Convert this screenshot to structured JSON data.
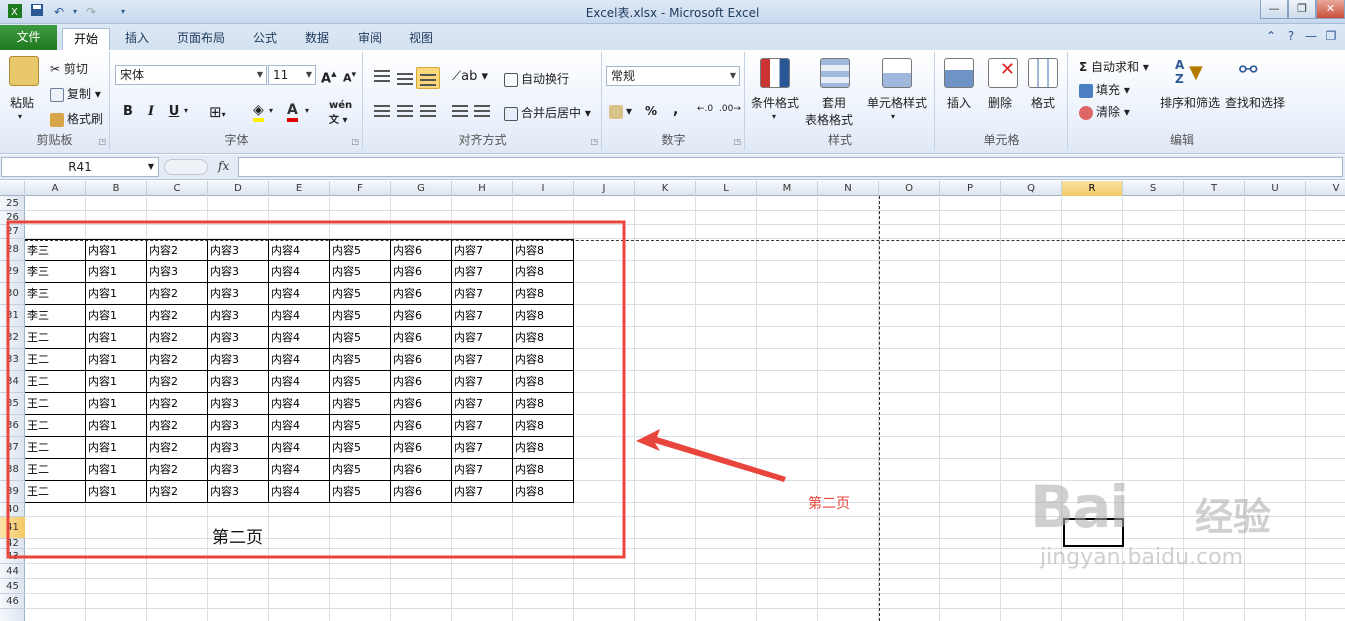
{
  "window": {
    "title": "Excel表.xlsx - Microsoft Excel"
  },
  "tabs": {
    "file": "文件",
    "items": [
      "开始",
      "插入",
      "页面布局",
      "公式",
      "数据",
      "审阅",
      "视图"
    ]
  },
  "ribbon": {
    "clipboard": {
      "paste": "粘贴",
      "cut": "剪切",
      "copy": "复制",
      "format_painter": "格式刷",
      "label": "剪贴板"
    },
    "font": {
      "name": "宋体",
      "size": "11",
      "label": "字体",
      "bold": "B",
      "italic": "I",
      "underline": "U"
    },
    "alignment": {
      "wrap": "自动换行",
      "merge": "合并后居中",
      "label": "对齐方式"
    },
    "number": {
      "format": "常规",
      "label": "数字",
      "percent": "%",
      "comma": ","
    },
    "styles": {
      "conditional": "条件格式",
      "table_line1": "套用",
      "table_line2": "表格格式",
      "cell_styles": "单元格样式",
      "label": "样式"
    },
    "cells": {
      "insert": "插入",
      "delete": "删除",
      "format": "格式",
      "label": "单元格"
    },
    "editing": {
      "autosum": "自动求和",
      "fill": "填充",
      "clear": "清除",
      "sort": "排序和筛选",
      "find": "查找和选择",
      "label": "编辑"
    }
  },
  "formula_bar": {
    "name_box": "R41",
    "fx": "fx",
    "content": ""
  },
  "columns": [
    "A",
    "B",
    "C",
    "D",
    "E",
    "F",
    "G",
    "H",
    "I",
    "J",
    "K",
    "L",
    "M",
    "N",
    "O",
    "P",
    "Q",
    "R",
    "S",
    "T",
    "U",
    "V"
  ],
  "selected_column": "R",
  "rows": [
    "25",
    "26",
    "27",
    "28",
    "29",
    "30",
    "31",
    "32",
    "33",
    "34",
    "35",
    "36",
    "37",
    "38",
    "39",
    "40",
    "41",
    "42",
    "43",
    "44",
    "45",
    "46"
  ],
  "selected_row": "41",
  "table": [
    [
      "李三",
      "内容1",
      "内容2",
      "内容3",
      "内容4",
      "内容5",
      "内容6",
      "内容7",
      "内容8"
    ],
    [
      "李三",
      "内容1",
      "内容3",
      "内容3",
      "内容4",
      "内容5",
      "内容6",
      "内容7",
      "内容8"
    ],
    [
      "李三",
      "内容1",
      "内容2",
      "内容3",
      "内容4",
      "内容5",
      "内容6",
      "内容7",
      "内容8"
    ],
    [
      "李三",
      "内容1",
      "内容2",
      "内容3",
      "内容4",
      "内容5",
      "内容6",
      "内容7",
      "内容8"
    ],
    [
      "王二",
      "内容1",
      "内容2",
      "内容3",
      "内容4",
      "内容5",
      "内容6",
      "内容7",
      "内容8"
    ],
    [
      "王二",
      "内容1",
      "内容2",
      "内容3",
      "内容4",
      "内容5",
      "内容6",
      "内容7",
      "内容8"
    ],
    [
      "王二",
      "内容1",
      "内容2",
      "内容3",
      "内容4",
      "内容5",
      "内容6",
      "内容7",
      "内容8"
    ],
    [
      "王二",
      "内容1",
      "内容2",
      "内容3",
      "内容4",
      "内容5",
      "内容6",
      "内容7",
      "内容8"
    ],
    [
      "王二",
      "内容1",
      "内容2",
      "内容3",
      "内容4",
      "内容5",
      "内容6",
      "内容7",
      "内容8"
    ],
    [
      "王二",
      "内容1",
      "内容2",
      "内容3",
      "内容4",
      "内容5",
      "内容6",
      "内容7",
      "内容8"
    ],
    [
      "王二",
      "内容1",
      "内容2",
      "内容3",
      "内容4",
      "内容5",
      "内容6",
      "内容7",
      "内容8"
    ],
    [
      "王二",
      "内容1",
      "内容2",
      "内容3",
      "内容4",
      "内容5",
      "内容6",
      "内容7",
      "内容8"
    ]
  ],
  "page_label": "第二页",
  "annotation": {
    "text": "第二页",
    "color": "#e8453c"
  },
  "watermark": {
    "main": "Bai",
    "brand": "经验",
    "url": "jingyan.baidu.com"
  },
  "colors": {
    "accent_green": "#1f7a1f",
    "ribbon_blue": "#dde8f5",
    "selection": "#f3c864"
  }
}
